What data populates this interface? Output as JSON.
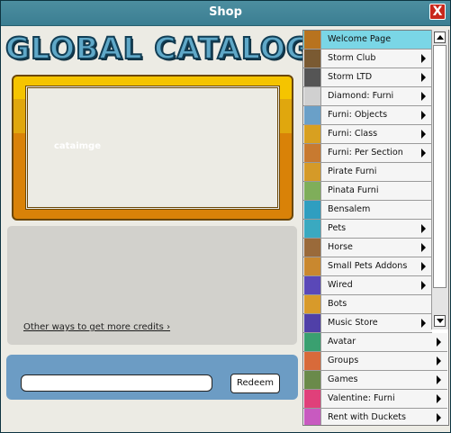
{
  "window": {
    "title": "Shop",
    "close_label": "X"
  },
  "header": {
    "logo_text": "GLOBAL CATALOG"
  },
  "promo": {
    "image_alt": "cataimge"
  },
  "info": {
    "credits_link": "Other ways to get more credits ›"
  },
  "redeem": {
    "voucher_value": "",
    "button_label": "Redeem"
  },
  "nav": {
    "items": [
      {
        "label": "Welcome Page",
        "icon": "gift-box-icon",
        "color": "#b8731f",
        "arrow": false
      },
      {
        "label": "Storm Club",
        "icon": "club-icon",
        "color": "#7a5a32",
        "arrow": true
      },
      {
        "label": "Storm LTD",
        "icon": "ltd-icon",
        "color": "#555555",
        "arrow": true
      },
      {
        "label": "Diamond: Furni",
        "icon": "diamond-icon",
        "color": "#d0d0d0",
        "arrow": true
      },
      {
        "label": "Furni: Objects",
        "icon": "table-icon",
        "color": "#6aa0c8",
        "arrow": true
      },
      {
        "label": "Furni: Class",
        "icon": "star-icon",
        "color": "#d8a020",
        "arrow": true
      },
      {
        "label": "Furni: Per Section",
        "icon": "thumb-icon",
        "color": "#c87a30",
        "arrow": true
      },
      {
        "label": "Pirate Furni",
        "icon": "cube-icon",
        "color": "#d59a28",
        "arrow": false
      },
      {
        "label": "Pinata Furni",
        "icon": "pinata-icon",
        "color": "#7fae5a",
        "arrow": false
      },
      {
        "label": "Bensalem",
        "icon": "fish-icon",
        "color": "#2f9ec0",
        "arrow": false
      },
      {
        "label": "Pets",
        "icon": "pet-icon",
        "color": "#3aa9c0",
        "arrow": true
      },
      {
        "label": "Horse",
        "icon": "horse-icon",
        "color": "#9a6a3a",
        "arrow": true
      },
      {
        "label": "Small Pets Addons",
        "icon": "dog-icon",
        "color": "#c9882f",
        "arrow": true
      },
      {
        "label": "Wired",
        "icon": "wired-icon",
        "color": "#5a48b8",
        "arrow": true
      },
      {
        "label": "Bots",
        "icon": "bot-icon",
        "color": "#d89a2a",
        "arrow": false
      },
      {
        "label": "Music Store",
        "icon": "music-note-icon",
        "color": "#5040a8",
        "arrow": true
      },
      {
        "label": "Avatar",
        "icon": "avatar-icon",
        "color": "#3aa070",
        "arrow": true
      },
      {
        "label": "Groups",
        "icon": "groups-icon",
        "color": "#d86a3a",
        "arrow": true
      },
      {
        "label": "Games",
        "icon": "joystick-icon",
        "color": "#6a8a4a",
        "arrow": true
      },
      {
        "label": "Valentine: Furni",
        "icon": "heart-icon",
        "color": "#e0407a",
        "arrow": true
      },
      {
        "label": "Rent with Duckets",
        "icon": "ducket-icon",
        "color": "#c85ac0",
        "arrow": true
      }
    ]
  }
}
